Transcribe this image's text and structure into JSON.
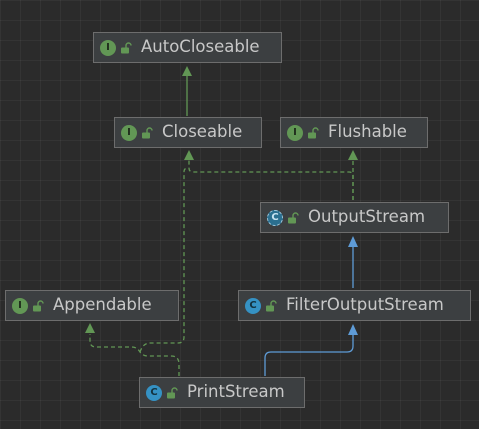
{
  "colors": {
    "background": "#2b2b2b",
    "node_fill": "#3c3f41",
    "node_border": "#6d6d6d",
    "text": "#c8c8c8",
    "interface_icon": "#629755",
    "class_icon": "#3592c4",
    "extends_edge": "#5e9bd6",
    "implements_edge": "#629755"
  },
  "nodes": {
    "autocloseable": {
      "label": "AutoCloseable",
      "kind": "interface",
      "icon_text": "I"
    },
    "closeable": {
      "label": "Closeable",
      "kind": "interface",
      "icon_text": "I"
    },
    "flushable": {
      "label": "Flushable",
      "kind": "interface",
      "icon_text": "I"
    },
    "outputstream": {
      "label": "OutputStream",
      "kind": "abstract-class",
      "icon_text": "C"
    },
    "appendable": {
      "label": "Appendable",
      "kind": "interface",
      "icon_text": "I"
    },
    "filteroutputstream": {
      "label": "FilterOutputStream",
      "kind": "class",
      "icon_text": "C"
    },
    "printstream": {
      "label": "PrintStream",
      "kind": "class",
      "icon_text": "C"
    }
  },
  "edges": [
    {
      "from": "closeable",
      "to": "autocloseable",
      "type": "extends-interface"
    },
    {
      "from": "outputstream",
      "to": "closeable",
      "type": "implements"
    },
    {
      "from": "outputstream",
      "to": "flushable",
      "type": "implements"
    },
    {
      "from": "filteroutputstream",
      "to": "outputstream",
      "type": "extends"
    },
    {
      "from": "printstream",
      "to": "filteroutputstream",
      "type": "extends"
    },
    {
      "from": "printstream",
      "to": "appendable",
      "type": "implements"
    },
    {
      "from": "printstream",
      "to": "closeable",
      "type": "implements"
    }
  ]
}
